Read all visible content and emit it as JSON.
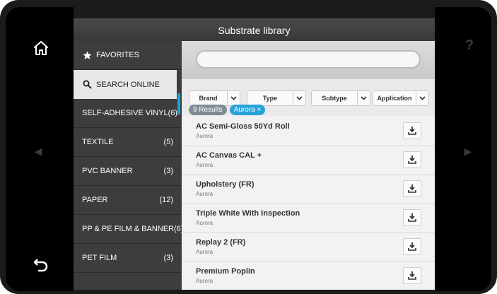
{
  "header": {
    "title": "Substrate library"
  },
  "sidebar": {
    "items": [
      {
        "label": "FAVORITES",
        "count": ""
      },
      {
        "label": "SEARCH ONLINE",
        "count": ""
      },
      {
        "label": "SELF-ADHESIVE VINYL",
        "count": "(6)"
      },
      {
        "label": "TEXTILE",
        "count": "(5)"
      },
      {
        "label": "PVC BANNER",
        "count": "(3)"
      },
      {
        "label": "PAPER",
        "count": "(12)"
      },
      {
        "label": "PP & PE FILM & BANNER",
        "count": "(6)"
      },
      {
        "label": "PET FILM",
        "count": "(3)"
      }
    ]
  },
  "search": {
    "value": "",
    "placeholder": ""
  },
  "filters": [
    "Brand",
    "Type",
    "Subtype",
    "Application"
  ],
  "chips": {
    "results": "9 Results",
    "active_filter": "Aurora ×"
  },
  "substrates": [
    {
      "name": "AC Semi-Gloss 50Yd Roll",
      "brand": "Aurora"
    },
    {
      "name": "AC Canvas CAL +",
      "brand": "Aurora"
    },
    {
      "name": "Upholstery (FR)",
      "brand": "Aurora"
    },
    {
      "name": "Triple White With Inspection",
      "brand": "Aurora"
    },
    {
      "name": "Replay 2 (FR)",
      "brand": "Aurora"
    },
    {
      "name": "Premium Poplin",
      "brand": "Aurora"
    }
  ],
  "device": {
    "help_label": "?"
  },
  "colors": {
    "accent": "#27a3d8",
    "titlebar": "#3f3f3f",
    "sidebar": "#3d3d3d"
  }
}
